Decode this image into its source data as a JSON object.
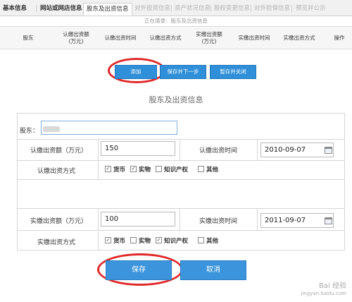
{
  "tabs": [
    {
      "label": "基本信息"
    },
    {
      "label": "网站或网店信息"
    },
    {
      "label": "股东及出资信息"
    },
    {
      "label": "对外投资信息"
    },
    {
      "label": "资产状况信息"
    },
    {
      "label": "股权变更信息"
    },
    {
      "label": "对外担保信息"
    },
    {
      "label": "预览并公示"
    }
  ],
  "status": "正在填录：股东及出资信息",
  "table_headers": [
    "股东",
    "认缴出资额\n(万元)",
    "认缴出资时间",
    "认缴出资方式",
    "实缴出资额\n(万元)",
    "实缴出资时间",
    "实缴出资方式",
    "操作"
  ],
  "top_buttons": {
    "add": "添加",
    "save_next": "保存并下一步",
    "save_close": "暂存并关闭"
  },
  "form": {
    "title": "股东及出资信息",
    "shareholder_label": "股东：",
    "subscribed_amount_label": "认缴出资额（万元）",
    "subscribed_amount": "150",
    "subscribed_date_label": "认缴出资时间",
    "subscribed_date": "2010-09-07",
    "subscribed_method_label": "认缴出资方式",
    "subscribed_methods": [
      {
        "label": "货币",
        "checked": true
      },
      {
        "label": "实物",
        "checked": true
      },
      {
        "label": "知识产权",
        "checked": false
      },
      {
        "label": "其他",
        "checked": false
      }
    ],
    "paid_amount_label": "实缴出资额（万元）",
    "paid_amount": "100",
    "paid_date_label": "实缴出资时间",
    "paid_date": "2011-09-07",
    "paid_method_label": "实缴出资方式",
    "paid_methods": [
      {
        "label": "货币",
        "checked": true
      },
      {
        "label": "实物",
        "checked": false
      },
      {
        "label": "知识产权",
        "checked": true
      },
      {
        "label": "其他",
        "checked": false
      }
    ]
  },
  "bottom_buttons": {
    "save": "保存",
    "cancel": "取消"
  },
  "watermark": {
    "line1": "Bai 经验",
    "line2": "jingyan.baidu.com"
  },
  "colors": {
    "primary_button": "#3b94dc",
    "highlight_ring": "#e02a2a"
  }
}
